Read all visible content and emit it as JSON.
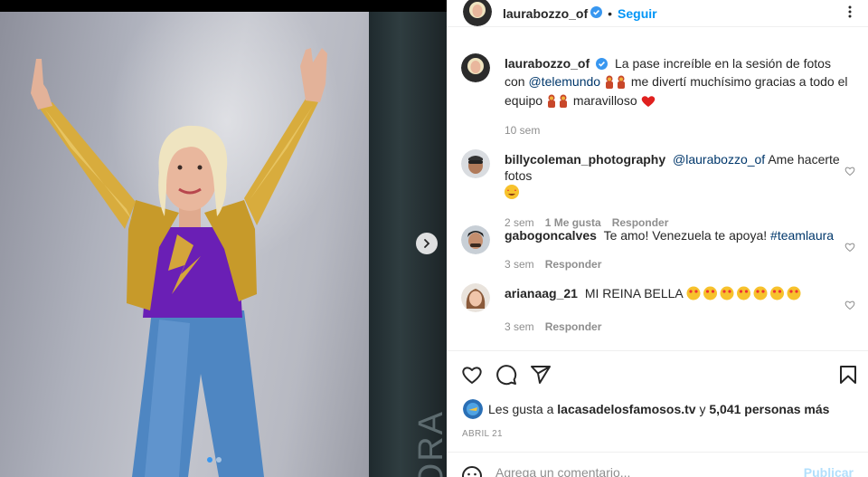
{
  "post": {
    "username": "laurabozzo_of",
    "follow_label": "Seguir",
    "caption": {
      "username": "laurabozzo_of",
      "text_1": "La pase increíble en la sesión de fotos con",
      "mention": "@telemundo",
      "text_2": "me divertí muchísimo gracias a todo el equipo",
      "text_3": "maravilloso",
      "time": "10 sem"
    },
    "comments": [
      {
        "username": "billycoleman_photography",
        "mention": "@laurabozzo_of",
        "text": "Ame hacerte fotos",
        "time": "2 sem",
        "likes": "1 Me gusta",
        "reply": "Responder"
      },
      {
        "username": "gabogoncalves",
        "text": "Te amo! Venezuela te apoya!",
        "hashtag": "#teamlaura",
        "time": "3 sem",
        "reply": "Responder"
      },
      {
        "username": "arianaag_21",
        "text": "MI REINA BELLA",
        "time": "3 sem",
        "reply": "Responder"
      }
    ],
    "likes": {
      "prefix": "Les gusta a",
      "account": "lacasadelosfamosos.tv",
      "connector": "y",
      "others": "5,041 personas más"
    },
    "date": "ABRIL 21",
    "comment_input": {
      "placeholder": "Agrega un comentario...",
      "publish_label": "Publicar"
    }
  },
  "colors": {
    "accent": "#0095f6",
    "link": "#00376b",
    "muted": "#8e8e8e",
    "heart": "#ed4956",
    "verified": "#3897f0"
  },
  "icons": [
    "verified-badge-icon",
    "more-options-icon",
    "slide-next-icon",
    "like-heart-icon",
    "comment-icon",
    "share-icon",
    "save-bookmark-icon",
    "emoji-icon"
  ]
}
